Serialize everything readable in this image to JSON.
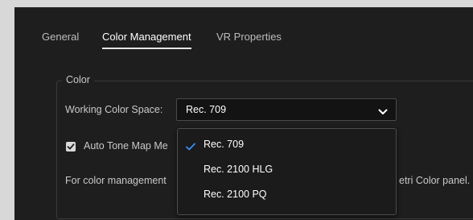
{
  "tabs": [
    {
      "label": "General",
      "active": false
    },
    {
      "label": "Color Management",
      "active": true
    },
    {
      "label": "VR Properties",
      "active": false
    }
  ],
  "color_group": {
    "legend": "Color",
    "working_color_space": {
      "label": "Working Color Space:",
      "value": "Rec. 709",
      "options": [
        "Rec. 709",
        "Rec. 2100 HLG",
        "Rec. 2100 PQ"
      ],
      "selected_index": 0
    },
    "auto_tone_map": {
      "label": "Auto Tone Map Me",
      "checked": true
    },
    "note_start": "For color management",
    "note_end": "etri Color panel."
  },
  "colors": {
    "panel_bg": "#1e1e1e",
    "check_accent": "#3b8cf0"
  },
  "icons": {
    "chevron": "chevron-down-icon",
    "check": "checkmark-icon"
  }
}
